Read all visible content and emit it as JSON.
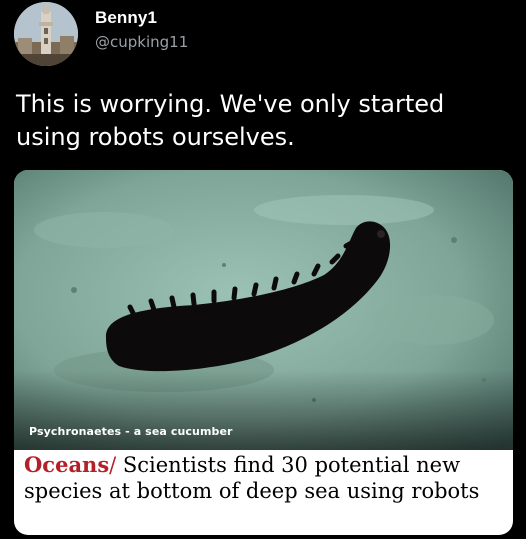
{
  "user": {
    "display_name": "Benny1",
    "handle": "@cupking11",
    "avatar_icon": "tower-photo-avatar"
  },
  "tweet": {
    "text": "This is worrying. We've only started using robots ourselves."
  },
  "card": {
    "photo_caption": "Psychronaetes - a sea cucumber",
    "section": "Oceans",
    "separator": "/",
    "headline": " Scientists find 30 potential new species at bottom of deep sea using robots"
  },
  "colors": {
    "background": "#000000",
    "handle_gray": "#9aa0a6",
    "section_red": "#b3202a",
    "seafloor": "#7fa79b"
  }
}
